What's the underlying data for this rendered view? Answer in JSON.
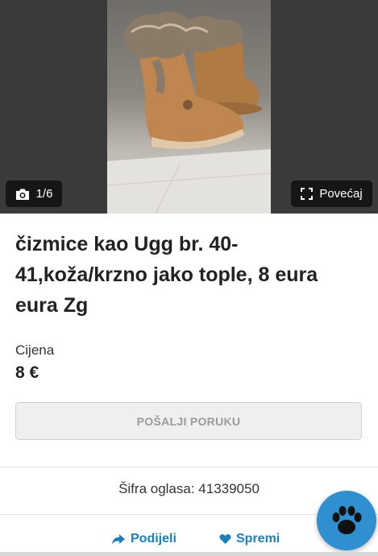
{
  "gallery": {
    "counter": "1/6",
    "zoom_label": "Povećaj"
  },
  "listing": {
    "title": "čizmice kao Ugg br. 40-41,koža/krzno jako tople, 8 eura eura Zg",
    "price_label": "Cijena",
    "price": "8 €",
    "message_button": "POŠALJI PORUKU",
    "ad_code": "Šifra oglasa: 41339050"
  },
  "actions": {
    "share_label": "Podijeli",
    "save_label": "Spremi"
  },
  "icons": {
    "camera": "camera-icon",
    "zoom": "expand-icon",
    "share": "share-arrow-icon",
    "save": "heart-icon",
    "chat": "paw-icon"
  },
  "colors": {
    "accent": "#1c7fb6",
    "chat_button": "#2f8fcf"
  }
}
